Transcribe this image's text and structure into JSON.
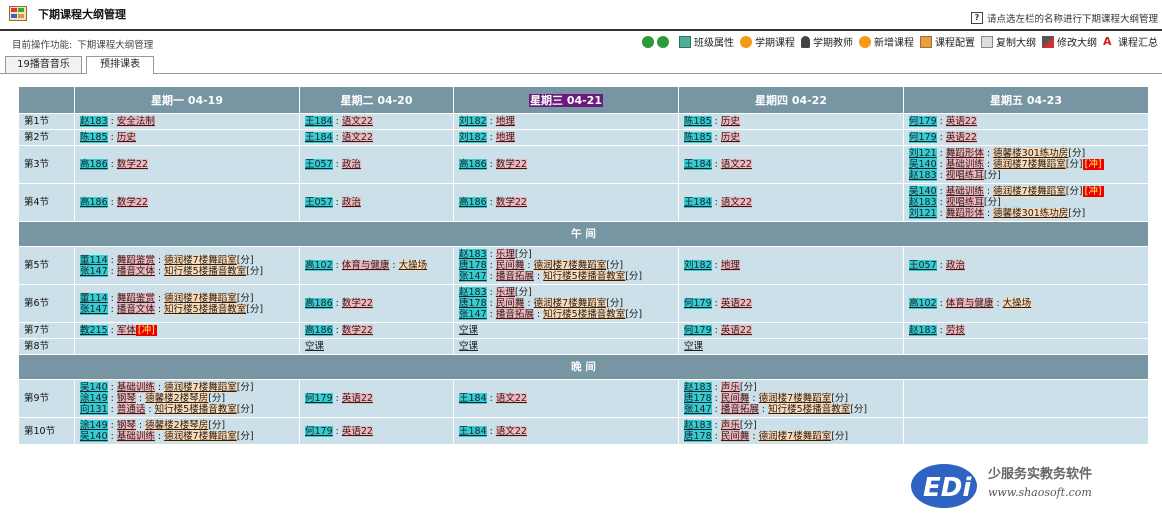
{
  "header": {
    "title": "下期课程大纲管理",
    "hint": "请点选左栏的名称进行下期课程大纲管理"
  },
  "crumb": {
    "label": "目前操作功能:",
    "value": "下期课程大纲管理"
  },
  "toolbar": {
    "items": [
      "班级属性",
      "学期课程",
      "学期教师",
      "新增课程",
      "课程配置",
      "复制大纲",
      "修改大纲",
      "课程汇总"
    ]
  },
  "tabs": [
    {
      "label": "19播音音乐"
    },
    {
      "label": "预排课表"
    }
  ],
  "grid": {
    "days": [
      "星期一 04-19",
      "星期二 04-20",
      "星期三 04-21",
      "星期四 04-22",
      "星期五 04-23"
    ],
    "noon": "午 间",
    "evening": "晚 间",
    "empty": "空课",
    "rows": [
      {
        "p": "第1节",
        "cells": [
          [
            {
              "t": "赵183",
              "c": "安全法制"
            }
          ],
          [
            {
              "t": "王184",
              "c": "语文22"
            }
          ],
          [
            {
              "t": "刘182",
              "c": "地理"
            }
          ],
          [
            {
              "t": "陈185",
              "c": "历史"
            }
          ],
          [
            {
              "t": "何179",
              "c": "英语22"
            }
          ]
        ]
      },
      {
        "p": "第2节",
        "cells": [
          [
            {
              "t": "陈185",
              "c": "历史"
            }
          ],
          [
            {
              "t": "王184",
              "c": "语文22"
            }
          ],
          [
            {
              "t": "刘182",
              "c": "地理"
            }
          ],
          [
            {
              "t": "陈185",
              "c": "历史"
            }
          ],
          [
            {
              "t": "何179",
              "c": "英语22"
            }
          ]
        ]
      },
      {
        "p": "第3节",
        "cells": [
          [
            {
              "t": "高186",
              "c": "数学22"
            }
          ],
          [
            {
              "t": "王057",
              "c": "政治"
            }
          ],
          [
            {
              "t": "高186",
              "c": "数学22"
            }
          ],
          [
            {
              "t": "王184",
              "c": "语文22"
            }
          ],
          [
            {
              "t": "刘121",
              "c": "舞蹈形体",
              "r": "德馨楼301练功房",
              "x": "[分]"
            },
            {
              "t": "吴140",
              "c": "基础训练",
              "r": "德润楼7楼舞蹈室",
              "x": "[分]",
              "f": "[冲]"
            },
            {
              "t": "赵183",
              "c": "视唱练耳",
              "x": "[分]"
            }
          ]
        ]
      },
      {
        "p": "第4节",
        "cells": [
          [
            {
              "t": "高186",
              "c": "数学22"
            }
          ],
          [
            {
              "t": "王057",
              "c": "政治"
            }
          ],
          [
            {
              "t": "高186",
              "c": "数学22"
            }
          ],
          [
            {
              "t": "王184",
              "c": "语文22"
            }
          ],
          [
            {
              "t": "吴140",
              "c": "基础训练",
              "r": "德润楼7楼舞蹈室",
              "x": "[分]",
              "f": "[冲]"
            },
            {
              "t": "赵183",
              "c": "视唱练耳",
              "x": "[分]"
            },
            {
              "t": "刘121",
              "c": "舞蹈形体",
              "r": "德馨楼301练功房",
              "x": "[分]"
            }
          ]
        ]
      },
      {
        "p": "第5节",
        "cells": [
          [
            {
              "t": "董114",
              "c": "舞蹈鉴赏",
              "r": "德润楼7楼舞蹈室",
              "x": "[分]"
            },
            {
              "t": "张147",
              "c": "播音文体",
              "r": "知行楼5楼播音教室",
              "x": "[分]"
            }
          ],
          [
            {
              "t": "高102",
              "c": "体育与健康",
              "r": "大操场"
            }
          ],
          [
            {
              "t": "赵183",
              "c": "乐理",
              "x": "[分]"
            },
            {
              "t": "唐178",
              "c": "民间舞",
              "r": "德润楼7楼舞蹈室",
              "x": "[分]"
            },
            {
              "t": "张147",
              "c": "播音拓展",
              "r": "知行楼5楼播音教室",
              "x": "[分]"
            }
          ],
          [
            {
              "t": "刘182",
              "c": "地理"
            }
          ],
          [
            {
              "t": "王057",
              "c": "政治"
            }
          ]
        ]
      },
      {
        "p": "第6节",
        "cells": [
          [
            {
              "t": "董114",
              "c": "舞蹈鉴赏",
              "r": "德润楼7楼舞蹈室",
              "x": "[分]"
            },
            {
              "t": "张147",
              "c": "播音文体",
              "r": "知行楼5楼播音教室",
              "x": "[分]"
            }
          ],
          [
            {
              "t": "高186",
              "c": "数学22"
            }
          ],
          [
            {
              "t": "赵183",
              "c": "乐理",
              "x": "[分]"
            },
            {
              "t": "唐178",
              "c": "民间舞",
              "r": "德润楼7楼舞蹈室",
              "x": "[分]"
            },
            {
              "t": "张147",
              "c": "播音拓展",
              "r": "知行楼5楼播音教室",
              "x": "[分]"
            }
          ],
          [
            {
              "t": "何179",
              "c": "英语22"
            }
          ],
          [
            {
              "t": "高102",
              "c": "体育与健康",
              "r": "大操场"
            }
          ]
        ]
      },
      {
        "p": "第7节",
        "cells": [
          [
            {
              "t": "教215",
              "c": "军体",
              "f": "[冲]"
            }
          ],
          [
            {
              "t": "高186",
              "c": "数学22"
            }
          ],
          "empty",
          [
            {
              "t": "何179",
              "c": "英语22"
            }
          ],
          [
            {
              "t": "赵183",
              "c": "劳技"
            }
          ]
        ]
      },
      {
        "p": "第8节",
        "cells": [
          [],
          "empty",
          "empty",
          "empty",
          []
        ]
      },
      {
        "p": "第9节",
        "cells": [
          [
            {
              "t": "吴140",
              "c": "基础训练",
              "r": "德润楼7楼舞蹈室",
              "x": "[分]"
            },
            {
              "t": "涂149",
              "c": "钢琴",
              "r": "德馨楼2楼琴房",
              "x": "[分]"
            },
            {
              "t": "向131",
              "c": "普通话",
              "r": "知行楼5楼播音教室",
              "x": "[分]"
            }
          ],
          [
            {
              "t": "何179",
              "c": "英语22"
            }
          ],
          [
            {
              "t": "王184",
              "c": "语文22"
            }
          ],
          [
            {
              "t": "赵183",
              "c": "声乐",
              "x": "[分]"
            },
            {
              "t": "唐178",
              "c": "民间舞",
              "r": "德润楼7楼舞蹈室",
              "x": "[分]"
            },
            {
              "t": "张147",
              "c": "播音拓展",
              "r": "知行楼5楼播音教室",
              "x": "[分]"
            }
          ],
          []
        ]
      },
      {
        "p": "第10节",
        "cells": [
          [
            {
              "t": "涂149",
              "c": "钢琴",
              "r": "德馨楼2楼琴房",
              "x": "[分]"
            },
            {
              "t": "吴140",
              "c": "基础训练",
              "r": "德润楼7楼舞蹈室",
              "x": "[分]"
            }
          ],
          [
            {
              "t": "何179",
              "c": "英语22"
            }
          ],
          [
            {
              "t": "王184",
              "c": "语文22"
            }
          ],
          [
            {
              "t": "赵183",
              "c": "声乐",
              "x": "[分]"
            },
            {
              "t": "唐178",
              "c": "民间舞",
              "r": "德润楼7楼舞蹈室",
              "x": "[分]"
            }
          ],
          []
        ]
      }
    ]
  },
  "watermark": {
    "logo": "EDi",
    "brand": "少服务实教务软件",
    "url": "www.shaosoft.com"
  },
  "colors": {
    "header": "#7895a4",
    "cell": "#cbe0e9",
    "teacher": "#33cdd6",
    "course": "#f4b6bd",
    "room": "#fbd9b4",
    "flag": "#e00000",
    "today": "#6b1a7e"
  }
}
